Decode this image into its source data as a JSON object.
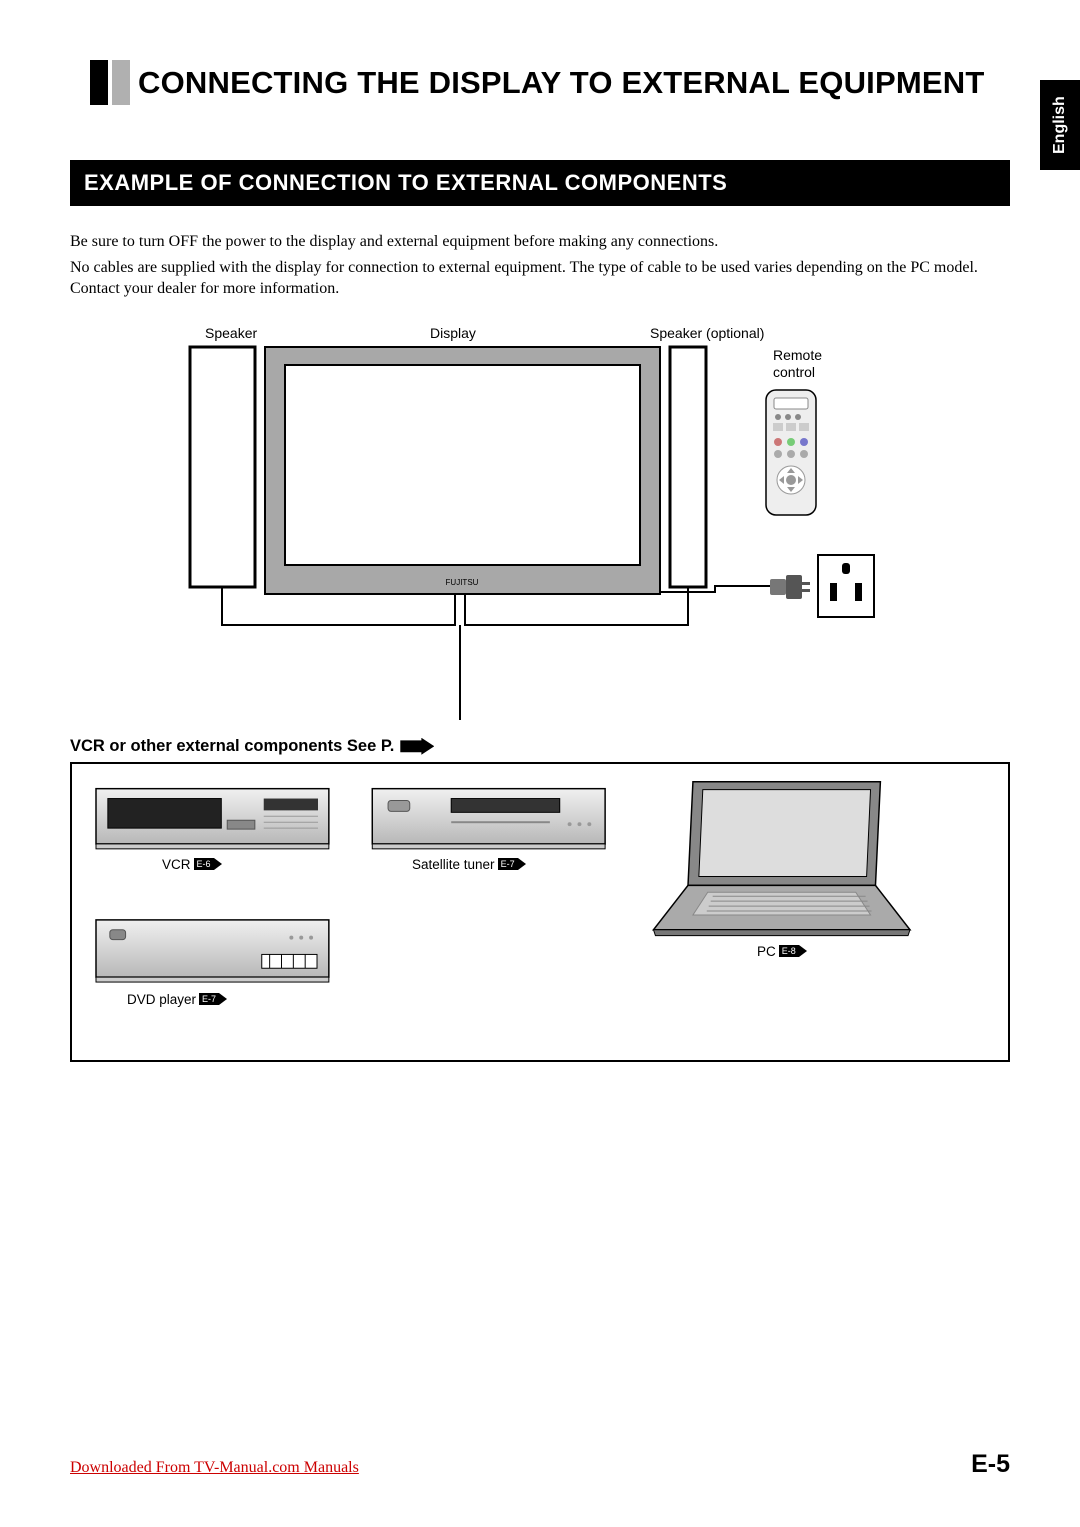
{
  "language_tab": "English",
  "title": "CONNECTING THE DISPLAY TO EXTERNAL EQUIPMENT",
  "subheading": "EXAMPLE OF CONNECTION TO EXTERNAL COMPONENTS",
  "paragraphs": {
    "p1": "Be sure to turn OFF the power to the display and external equipment before making any connections.",
    "p2": "No cables are supplied with the display for connection to external equipment.  The type of cable to be used varies depending on the PC model.  Contact your dealer for more information."
  },
  "diagram_labels": {
    "speaker_left": "Speaker",
    "display": "Display",
    "speaker_right": "Speaker (optional)",
    "remote": "Remote\ncontrol",
    "brand": "FUJITSU"
  },
  "external_heading": "VCR or other external components See P.",
  "components": {
    "vcr": {
      "label": "VCR",
      "ref": "E-6"
    },
    "satellite": {
      "label": "Satellite tuner",
      "ref": "E-7"
    },
    "dvd": {
      "label": "DVD player",
      "ref": "E-7"
    },
    "pc": {
      "label": "PC",
      "ref": "E-8"
    }
  },
  "download_text": "Downloaded From TV-Manual.com Manuals",
  "page_number": "E-5"
}
